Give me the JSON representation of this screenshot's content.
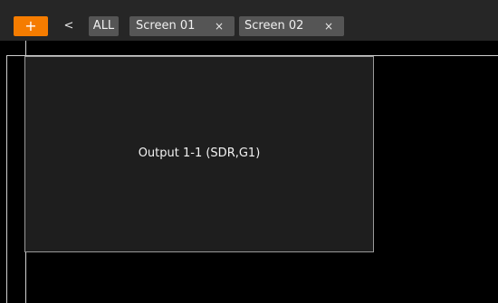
{
  "toolbar": {
    "add_label": "+",
    "back_label": "<"
  },
  "tabs": [
    {
      "label": "ALL"
    },
    {
      "label": "Screen 01",
      "close": "×"
    },
    {
      "label": "Screen 02",
      "close": "×"
    }
  ],
  "canvas": {
    "output": {
      "label": "Output 1-1 (SDR,G1)"
    }
  },
  "colors": {
    "accent": "#f57c00",
    "tab_background": "#555555",
    "toolbar_background": "#262626",
    "canvas_background": "#000000",
    "output_background": "#1e1e1e"
  }
}
